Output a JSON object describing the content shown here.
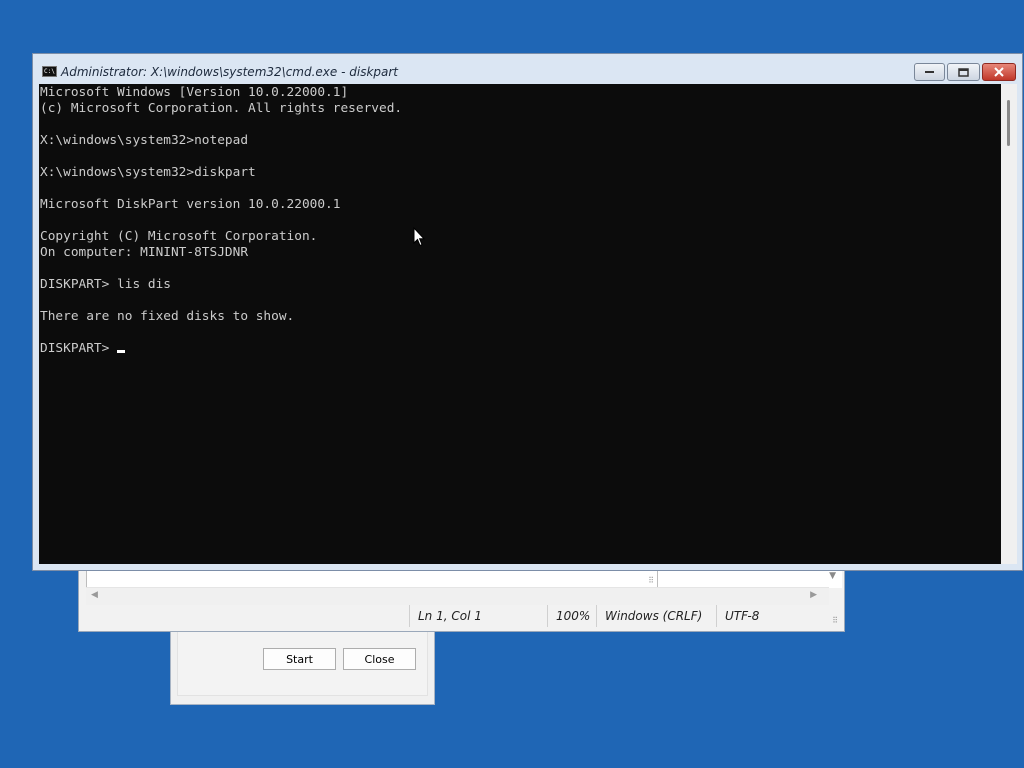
{
  "desktop": {
    "background_color": "#1f66b5"
  },
  "dialog": {
    "start_label": "Start",
    "close_label": "Close"
  },
  "notepad": {
    "status": {
      "position": "Ln 1, Col 1",
      "zoom": "100%",
      "line_endings": "Windows (CRLF)",
      "encoding": "UTF-8"
    }
  },
  "cmd": {
    "title": "Administrator: X:\\windows\\system32\\cmd.exe - diskpart",
    "icon": "console-app-icon",
    "icon_glyph": "C:\\",
    "buttons": {
      "minimize": "minimize-icon",
      "maximize": "maximize-icon",
      "close": "close-icon"
    },
    "lines": [
      "Microsoft Windows [Version 10.0.22000.1]",
      "(c) Microsoft Corporation. All rights reserved.",
      "",
      "X:\\windows\\system32>notepad",
      "",
      "X:\\windows\\system32>diskpart",
      "",
      "Microsoft DiskPart version 10.0.22000.1",
      "",
      "Copyright (C) Microsoft Corporation.",
      "On computer: MININT-8TSJDNR",
      "",
      "DISKPART> lis dis",
      "",
      "There are no fixed disks to show.",
      ""
    ],
    "prompt": "DISKPART> ",
    "colors": {
      "background": "#0c0c0c",
      "foreground": "#cccccc"
    }
  }
}
